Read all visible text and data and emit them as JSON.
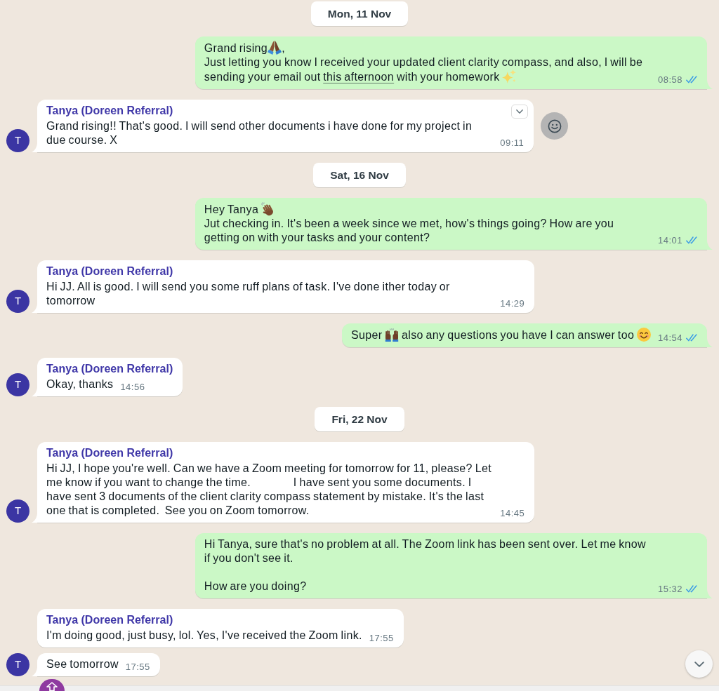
{
  "chat": {
    "items": [
      {
        "kind": "date",
        "label": "Mon, 11 Nov"
      },
      {
        "kind": "out",
        "parts": [
          {
            "kind": "text",
            "text": "Grand rising"
          },
          {
            "kind": "pray"
          },
          {
            "kind": "text",
            "text": ",\nJust letting you know I received your updated client clarity compass, and also, I will be sending your email out "
          },
          {
            "kind": "link",
            "text": "this afternoon"
          },
          {
            "kind": "text",
            "text": " with your homework "
          },
          {
            "kind": "sparkles"
          }
        ],
        "time": "08:58",
        "read": true,
        "hovered": false
      },
      {
        "kind": "in",
        "sender": "Tanya (Doreen Referral)",
        "parts": [
          {
            "kind": "text",
            "text": "Grand rising!! That's good. I will send other documents i have done for my project in due course. X"
          }
        ],
        "time": "09:11",
        "avatar": "T",
        "hovered": true
      },
      {
        "kind": "date",
        "label": "Sat, 16 Nov"
      },
      {
        "kind": "out",
        "parts": [
          {
            "kind": "text",
            "text": "Hey Tanya "
          },
          {
            "kind": "wave"
          },
          {
            "kind": "text",
            "text": "\nJut checking in. It's been a week since we met, how's things going? How are you getting on with your tasks and your content?"
          }
        ],
        "time": "14:01",
        "read": true,
        "hovered": false
      },
      {
        "kind": "in",
        "sender": "Tanya (Doreen Referral)",
        "parts": [
          {
            "kind": "text",
            "text": "Hi JJ. All is good. I will send you some ruff plans of task. I've done ither today or tomorrow"
          }
        ],
        "time": "14:29",
        "avatar": "T",
        "hovered": false
      },
      {
        "kind": "out",
        "parts": [
          {
            "kind": "text",
            "text": "Super "
          },
          {
            "kind": "praise"
          },
          {
            "kind": "text",
            "text": " also any questions you have I can answer too "
          },
          {
            "kind": "smile"
          }
        ],
        "time": "14:54",
        "read": true,
        "hovered": false
      },
      {
        "kind": "in",
        "sender": "Tanya (Doreen Referral)",
        "parts": [
          {
            "kind": "text",
            "text": "Okay, thanks"
          }
        ],
        "time": "14:56",
        "avatar": "T",
        "hovered": false
      },
      {
        "kind": "date",
        "label": "Fri, 22 Nov"
      },
      {
        "kind": "in",
        "sender": "Tanya (Doreen Referral)",
        "parts": [
          {
            "kind": "text",
            "text": "Hi JJ, I hope you're well. Can we have a Zoom meeting for tomorrow for 11, please? Let me know if you want to change the time.                I have sent you some documents. I have sent 3 documents of the client clarity compass statement by mistake. It's the last one that is completed.  See you on Zoom tomorrow."
          }
        ],
        "time": "14:45",
        "avatar": "T",
        "hovered": false
      },
      {
        "kind": "out",
        "parts": [
          {
            "kind": "text",
            "text": "Hi Tanya, sure that's no problem at all. The Zoom link has been sent over. Let me know if you don't see it.\n\nHow are you doing?"
          }
        ],
        "time": "15:32",
        "read": true,
        "hovered": false
      },
      {
        "kind": "in",
        "sender": "Tanya (Doreen Referral)",
        "parts": [
          {
            "kind": "text",
            "text": "I'm doing good, just busy, lol. Yes, I've received the Zoom link."
          }
        ],
        "time": "17:55",
        "hovered": false
      },
      {
        "kind": "in",
        "parts": [
          {
            "kind": "text",
            "text": "See tomorrow"
          }
        ],
        "time": "17:55",
        "avatar": "T",
        "hovered": false
      }
    ]
  }
}
